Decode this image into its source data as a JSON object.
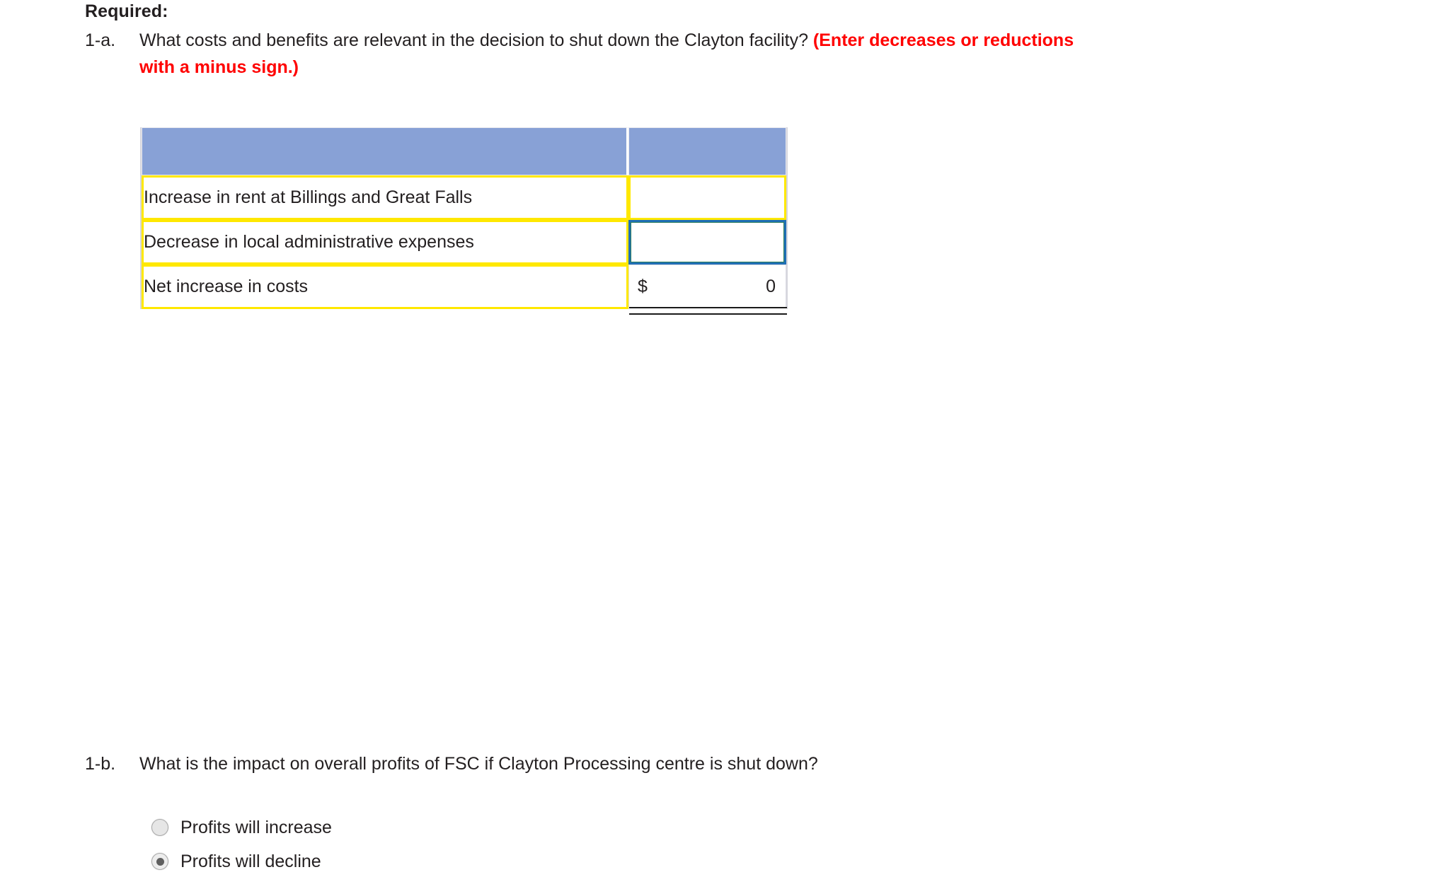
{
  "required_heading": "Required:",
  "question_1a": {
    "number": "1-a.",
    "text": "What costs and benefits are relevant in the decision to shut down the Clayton facility? ",
    "emphasis": "(Enter decreases or reductions with a minus sign.)"
  },
  "table": {
    "header": {
      "label_col": "",
      "value_col": ""
    },
    "rows": [
      {
        "label": "Increase in rent at Billings and Great Falls",
        "value": "",
        "state": "empty"
      },
      {
        "label": "Decrease in local administrative expenses",
        "value": "",
        "state": "focused"
      },
      {
        "label": "Net increase in costs",
        "currency": "$",
        "value": "0",
        "state": "total"
      }
    ]
  },
  "question_1b": {
    "number": "1-b.",
    "text": "What is the impact on overall profits of FSC if Clayton Processing centre is shut down?"
  },
  "radio_options": [
    {
      "label": "Profits will increase",
      "selected": false
    },
    {
      "label": "Profits will decline",
      "selected": true
    }
  ],
  "colors": {
    "header_blue": "#88a1d6",
    "cell_yellow": "#ffe800",
    "focus_blue": "#1f6fb5",
    "emphasis_red": "#ff0000",
    "text": "#231f20"
  }
}
